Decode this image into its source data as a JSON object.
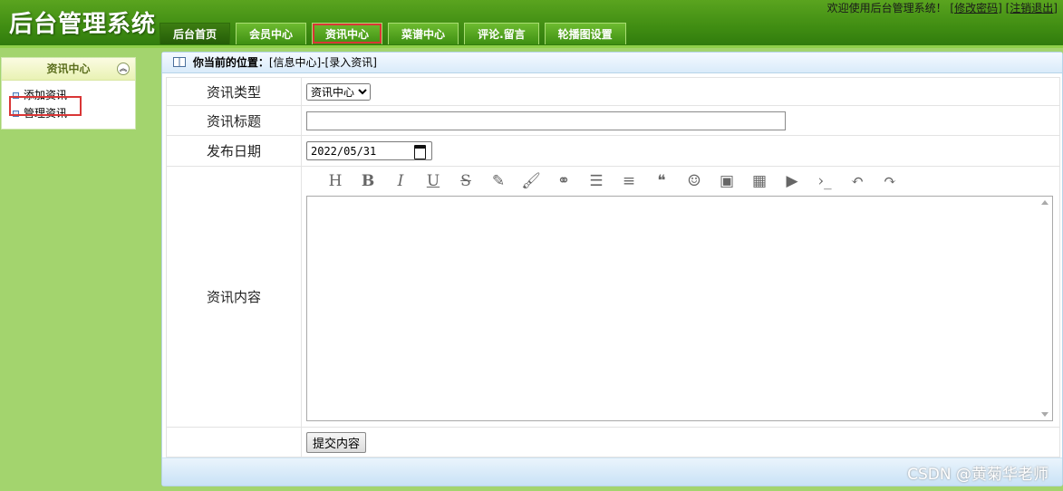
{
  "app": {
    "title": "后台管理系统"
  },
  "header": {
    "welcome_text": "欢迎使用后台管理系统！",
    "change_password": "[修改密码]",
    "logout": "[注销退出]"
  },
  "nav": {
    "tabs": [
      "后台首页",
      "会员中心",
      "资讯中心",
      "菜谱中心",
      "评论.留言",
      "轮播图设置"
    ]
  },
  "sidebar": {
    "title": "资讯中心",
    "collapse_icon": "chevron-double-up-icon",
    "items": [
      "添加资讯",
      "管理资讯"
    ]
  },
  "breadcrumb": {
    "label": "你当前的位置：",
    "path": "[信息中心]-[录入资讯]"
  },
  "form": {
    "type_label": "资讯类型",
    "type_selected": "资讯中心",
    "title_label": "资讯标题",
    "title_value": "",
    "date_label": "发布日期",
    "date_value": "2022/05/31",
    "content_label": "资讯内容",
    "submit_label": "提交内容"
  },
  "toolbar_icons": [
    "heading-icon",
    "bold-icon",
    "italic-icon",
    "underline-icon",
    "strikethrough-icon",
    "pen-icon",
    "brush-icon",
    "link-icon",
    "list-icon",
    "align-icon",
    "quote-icon",
    "emoji-icon",
    "image-icon",
    "table-icon",
    "video-icon",
    "code-icon",
    "undo-icon",
    "redo-icon"
  ],
  "toolbar_glyphs": [
    "H",
    "B",
    "I",
    "U",
    "S",
    "✎",
    "🖌",
    "⚭",
    "☰",
    "≡",
    "❝",
    "☺",
    "▣",
    "▦",
    "▶",
    "›_",
    "↶",
    "↷"
  ],
  "watermark": "CSDN @黄菊华老师",
  "colors": {
    "header_green": "#3f8c12",
    "sidebar_green": "#a3d46e",
    "highlight_red": "#d93636"
  }
}
